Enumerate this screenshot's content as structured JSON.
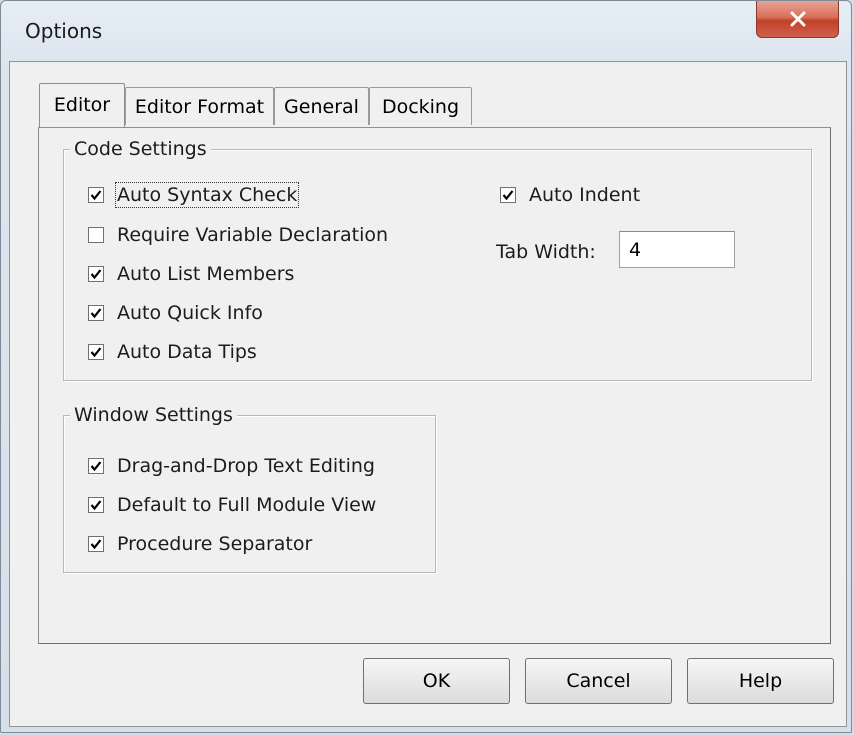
{
  "window": {
    "title": "Options"
  },
  "tabs": [
    {
      "label": "Editor",
      "active": true
    },
    {
      "label": "Editor Format",
      "active": false
    },
    {
      "label": "General",
      "active": false
    },
    {
      "label": "Docking",
      "active": false
    }
  ],
  "code_settings": {
    "title": "Code Settings",
    "options": [
      {
        "label": "Auto Syntax Check",
        "checked": true
      },
      {
        "label": "Require Variable Declaration",
        "checked": false
      },
      {
        "label": "Auto List Members",
        "checked": true
      },
      {
        "label": "Auto Quick Info",
        "checked": true
      },
      {
        "label": "Auto Data Tips",
        "checked": true
      }
    ],
    "auto_indent": {
      "label": "Auto Indent",
      "checked": true
    },
    "tab_width": {
      "label": "Tab Width:",
      "value": "4"
    }
  },
  "window_settings": {
    "title": "Window Settings",
    "options": [
      {
        "label": "Drag-and-Drop Text Editing",
        "checked": true
      },
      {
        "label": "Default to Full Module View",
        "checked": true
      },
      {
        "label": "Procedure Separator",
        "checked": true
      }
    ]
  },
  "buttons": {
    "ok": "OK",
    "cancel": "Cancel",
    "help": "Help"
  }
}
